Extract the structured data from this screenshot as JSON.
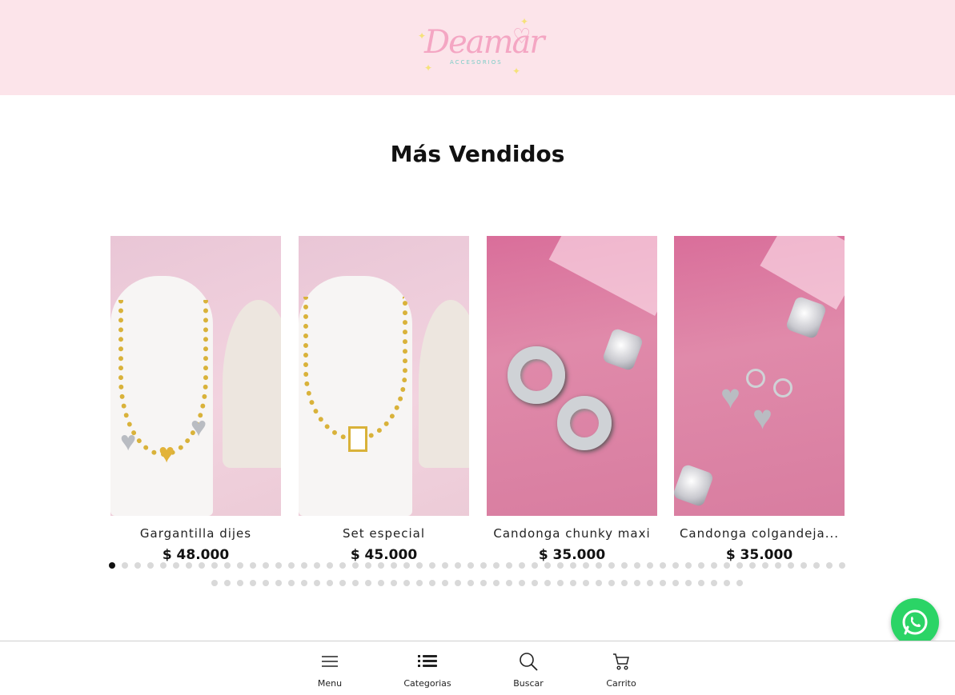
{
  "header": {
    "logo_text": "Deamar",
    "logo_subtext": "ACCESORIOS"
  },
  "section": {
    "title": "Más Vendidos"
  },
  "products": [
    {
      "name": "Gargantilla dijes",
      "price": "$ 48.000"
    },
    {
      "name": "Set especial",
      "price": "$ 45.000"
    },
    {
      "name": "Candonga chunky maxi",
      "price": "$ 35.000"
    },
    {
      "name": "Candonga colgandeja...",
      "price": "$ 35.000"
    }
  ],
  "carousel": {
    "active_index": 0
  },
  "bottom_nav": [
    {
      "label": "Menu",
      "icon": "menu-icon"
    },
    {
      "label": "Categorias",
      "icon": "list-icon"
    },
    {
      "label": "Buscar",
      "icon": "search-icon"
    },
    {
      "label": "Carrito",
      "icon": "cart-icon"
    }
  ],
  "colors": {
    "header_bg": "#fce4ea",
    "whatsapp": "#2bd466",
    "logo_pink": "#f4a6c3",
    "logo_teal": "#7ccdc7"
  }
}
